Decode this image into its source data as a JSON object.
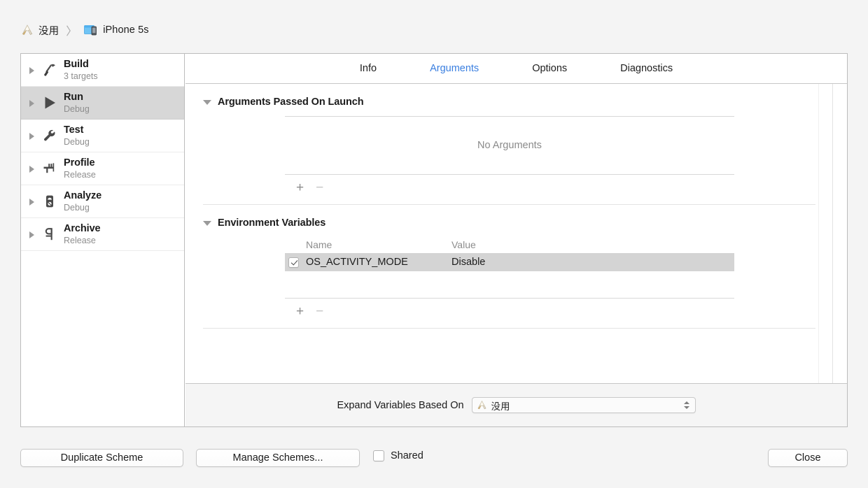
{
  "breadcrumb": {
    "project_icon": "xcode-project-icon",
    "project_name": "没用",
    "separator": "〉",
    "destination_icon": "simulator-device-icon",
    "destination_name": "iPhone 5s"
  },
  "sidebar": {
    "items": [
      {
        "title": "Build",
        "subtitle": "3 targets",
        "icon": "hammer-icon",
        "selected": false
      },
      {
        "title": "Run",
        "subtitle": "Debug",
        "icon": "play-icon",
        "selected": true
      },
      {
        "title": "Test",
        "subtitle": "Debug",
        "icon": "wrench-icon",
        "selected": false
      },
      {
        "title": "Profile",
        "subtitle": "Release",
        "icon": "gauge-icon",
        "selected": false
      },
      {
        "title": "Analyze",
        "subtitle": "Debug",
        "icon": "meter-icon",
        "selected": false
      },
      {
        "title": "Archive",
        "subtitle": "Release",
        "icon": "archive-icon",
        "selected": false
      }
    ]
  },
  "tabs": [
    {
      "label": "Info",
      "active": false
    },
    {
      "label": "Arguments",
      "active": true
    },
    {
      "label": "Options",
      "active": false
    },
    {
      "label": "Diagnostics",
      "active": false
    }
  ],
  "arguments_section": {
    "title": "Arguments Passed On Launch",
    "empty_text": "No Arguments",
    "add_label": "+",
    "remove_label": "−"
  },
  "environment_section": {
    "title": "Environment Variables",
    "columns": {
      "name": "Name",
      "value": "Value"
    },
    "rows": [
      {
        "checked": true,
        "name": "OS_ACTIVITY_MODE",
        "value": "Disable"
      }
    ],
    "add_label": "+",
    "remove_label": "−"
  },
  "expand_variables": {
    "label": "Expand Variables Based On",
    "selected_icon": "xcode-project-icon",
    "selected_value": "没用"
  },
  "bottom_bar": {
    "duplicate_label": "Duplicate Scheme",
    "manage_label": "Manage Schemes...",
    "shared_label": "Shared",
    "shared_checked": false,
    "close_label": "Close"
  },
  "colors": {
    "accent_blue": "#3a7fe0",
    "selection_gray": "#d7d7d7",
    "row_selection_gray": "#d4d4d4",
    "window_bg": "#f4f4f4",
    "panel_border": "#bcbcbc"
  }
}
